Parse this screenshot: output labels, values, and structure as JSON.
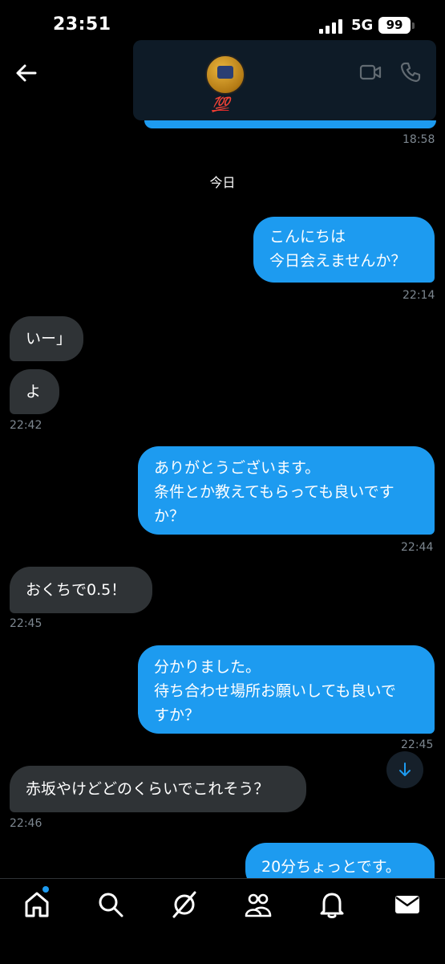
{
  "status_bar": {
    "time": "23:51",
    "network": "5G",
    "battery": "99"
  },
  "header": {
    "badge": "💯"
  },
  "previous_message": {
    "time": "18:58"
  },
  "day_separator": "今日",
  "messages": [
    {
      "direction": "out",
      "lines": [
        "こんにちは",
        "今日会えませんか？"
      ],
      "time": "22:14"
    },
    {
      "direction": "in",
      "lines": [
        "いー」"
      ],
      "time": ""
    },
    {
      "direction": "in",
      "lines": [
        "よ"
      ],
      "time": "22:42"
    },
    {
      "direction": "out",
      "lines": [
        "ありがとうございます。",
        "条件とか教えてもらっても良いです",
        "か？"
      ],
      "time": "22:44"
    },
    {
      "direction": "in",
      "lines": [
        "おくちで0.5！"
      ],
      "time": "22:45"
    },
    {
      "direction": "out",
      "lines": [
        "分かりました。",
        "待ち合わせ場所お願いしても良いで",
        "すか？"
      ],
      "time": "22:45"
    },
    {
      "direction": "in",
      "lines": [
        "赤坂やけどどのくらいでこれそう？"
      ],
      "time": "22:46"
    },
    {
      "direction": "out",
      "lines": [
        "20分ちょっとです。"
      ],
      "time": ""
    }
  ],
  "nav": {
    "items": [
      "home-icon",
      "search-icon",
      "grok-icon",
      "communities-icon",
      "notifications-icon",
      "messages-icon"
    ],
    "accent": "#1d9bf0"
  },
  "colors": {
    "outgoing": "#1d9bf0",
    "incoming": "#2f3336",
    "timestamp": "#7d8790"
  }
}
